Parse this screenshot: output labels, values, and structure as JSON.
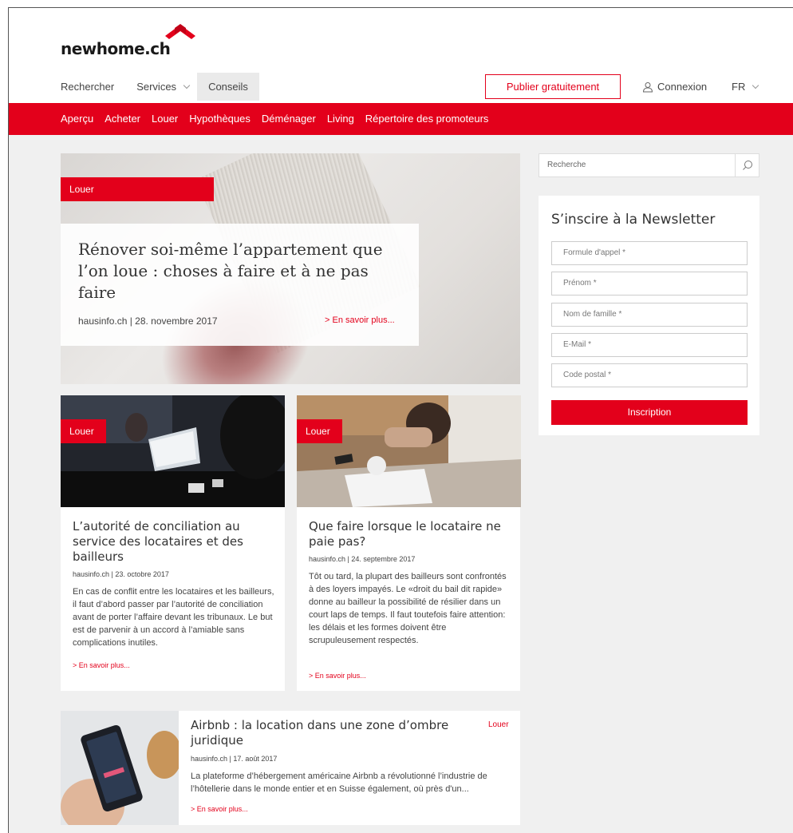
{
  "brand": {
    "name": "newhome.ch",
    "accent_color": "#e3001b"
  },
  "topnav": {
    "items": [
      "Rechercher",
      "Services",
      "Conseils"
    ],
    "publish_label": "Publier gratuitement",
    "login_label": "Connexion",
    "language": "FR"
  },
  "subnav": {
    "items": [
      "Aperçu",
      "Acheter",
      "Louer",
      "Hypothèques",
      "Déménager",
      "Living",
      "Répertoire des promoteurs"
    ]
  },
  "hero": {
    "tag": "Louer",
    "title": "Rénover soi-même l’appartement que l’on loue : choses à faire et à ne pas faire",
    "meta": "hausinfo.ch | 28. novembre 2017",
    "more": "> En savoir plus..."
  },
  "articles": [
    {
      "tag": "Louer",
      "title": "L’autorité de conciliation au service des locataires et des bailleurs",
      "meta": "hausinfo.ch | 23. octobre 2017",
      "text": "En cas de conflit entre les locataires et les bailleurs, il faut d’abord passer par l’autorité de conciliation avant de porter l’affaire devant les tribunaux. Le but est de parvenir à un accord à l’amiable sans complications inutiles.",
      "more": "> En savoir plus..."
    },
    {
      "tag": "Louer",
      "title": "Que faire lorsque le locataire ne paie pas?",
      "meta": "hausinfo.ch | 24. septembre 2017",
      "text": "Tôt ou tard, la plupart des bailleurs sont confrontés à des loyers impayés. Le «droit du bail dit rapide» donne au bailleur la possibilité de résilier dans un court laps de temps. Il faut toutefois faire attention: les délais et les formes doivent être scrupuleusement respectés.",
      "more": "> En savoir plus..."
    },
    {
      "tag": "Louer",
      "title": "Airbnb : la location dans une zone d’ombre juridique",
      "meta": "hausinfo.ch | 17. août 2017",
      "text": "La plateforme d’hébergement américaine Airbnb a révolutionné l’industrie de l’hôtellerie dans le monde entier et en Suisse également, où près d'un...",
      "more": "> En savoir plus..."
    }
  ],
  "sidebar": {
    "search_placeholder": "Recherche",
    "newsletter": {
      "title": "S’inscire à la Newsletter",
      "fields": [
        "Formule d'appel *",
        "Prénom *",
        "Nom de famille *",
        "E-Mail *",
        "Code postal *"
      ],
      "submit": "Inscription"
    }
  }
}
